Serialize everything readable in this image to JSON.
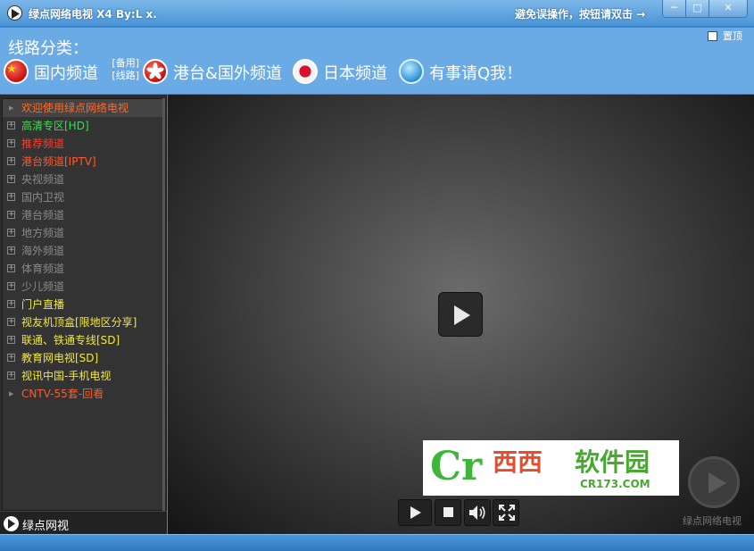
{
  "window": {
    "title": "绿点网络电视 X4   By:L x.",
    "hint": "避免误操作，按钮请双击 →",
    "min_label": "─",
    "max_label": "□",
    "close_label": "✕"
  },
  "header": {
    "route_label": "线路分类：",
    "pin_label": "置顶",
    "backup_label_line1": "[备用]",
    "backup_label_line2": "[线路]",
    "routes": [
      {
        "label": "国内频道"
      },
      {
        "label": "港台&国外频道"
      },
      {
        "label": "日本频道"
      },
      {
        "label": "有事请Q我！"
      }
    ]
  },
  "channels": [
    {
      "label": "欢迎使用绿点网络电视",
      "color": "#ff6a2a",
      "type": "leaf"
    },
    {
      "label": "高清专区[HD]",
      "color": "#37e04b",
      "type": "group"
    },
    {
      "label": "推荐频道",
      "color": "#ff3b2a",
      "type": "group"
    },
    {
      "label": "港台频道[IPTV]",
      "color": "#ff5a2a",
      "type": "group"
    },
    {
      "label": "央视频道",
      "color": "#8a8a8a",
      "type": "group"
    },
    {
      "label": "国内卫视",
      "color": "#8a8a8a",
      "type": "group"
    },
    {
      "label": "港台频道",
      "color": "#8a8a8a",
      "type": "group"
    },
    {
      "label": "地方频道",
      "color": "#8a8a8a",
      "type": "group"
    },
    {
      "label": "海外频道",
      "color": "#8a8a8a",
      "type": "group"
    },
    {
      "label": "体育频道",
      "color": "#8a8a8a",
      "type": "group"
    },
    {
      "label": "少儿频道",
      "color": "#8a8a8a",
      "type": "group"
    },
    {
      "label": "门户直播",
      "color": "#f2e83a",
      "type": "group"
    },
    {
      "label": "视友机顶盒[限地区分享]",
      "color": "#f2e83a",
      "type": "group"
    },
    {
      "label": "联通、铁通专线[SD]",
      "color": "#f2e83a",
      "type": "group"
    },
    {
      "label": "教育网电视[SD]",
      "color": "#f2e83a",
      "type": "group"
    },
    {
      "label": "视讯中国-手机电视",
      "color": "#f2e83a",
      "type": "group"
    },
    {
      "label": "CNTV-55套-回看",
      "color": "#ff5a2a",
      "type": "leaf"
    }
  ],
  "sidebar_footer": {
    "label": "绿点网视"
  },
  "player": {
    "corner_label": "绿点网络电视"
  },
  "watermark": {
    "logo_text": "Cr",
    "name_part1": "西西",
    "name_part2": "软件园",
    "sub": "CR173.COM"
  }
}
